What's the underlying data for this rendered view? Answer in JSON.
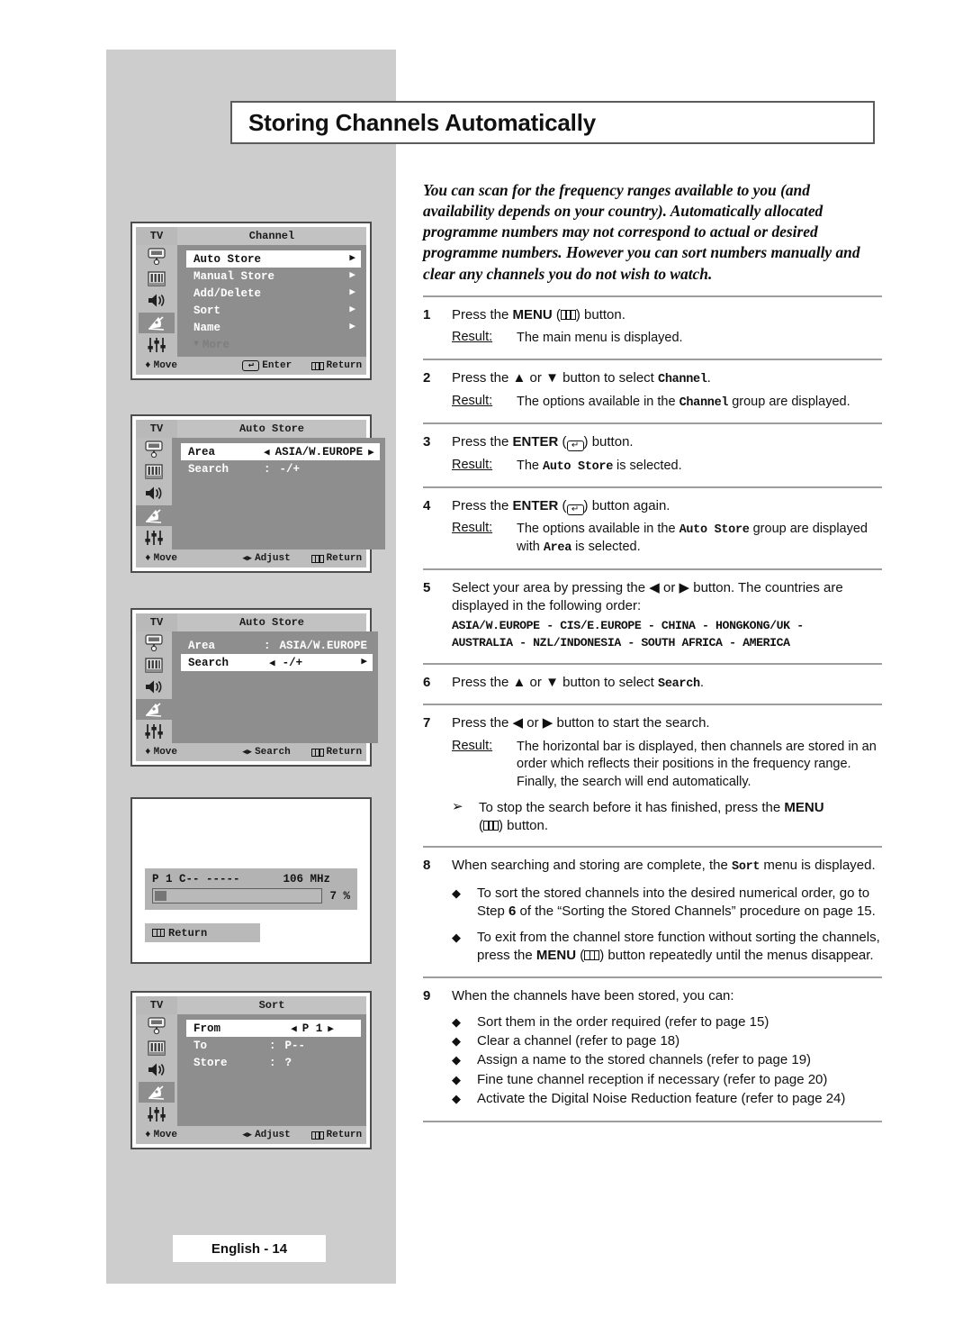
{
  "page": {
    "title": "Storing Channels Automatically",
    "footer": "English - 14"
  },
  "intro": "You can scan for the frequency ranges available to you (and availability depends on your country). Automatically allocated programme numbers may not correspond to actual or desired programme numbers. However you can sort numbers manually and clear any channels you do not wish to watch.",
  "osd": {
    "channel_menu": {
      "source_label": "TV",
      "title": "Channel",
      "items": [
        {
          "label": "Auto Store",
          "selected": true
        },
        {
          "label": "Manual Store",
          "selected": false
        },
        {
          "label": "Add/Delete",
          "selected": false
        },
        {
          "label": "Sort",
          "selected": false
        },
        {
          "label": "Name",
          "selected": false
        }
      ],
      "more_label": "More",
      "footer": {
        "move": "Move",
        "enter": "Enter",
        "return": "Return"
      }
    },
    "auto_store_area": {
      "source_label": "TV",
      "title": "Auto Store",
      "rows": [
        {
          "label": "Area",
          "value": "ASIA/W.EUROPE",
          "selected": true,
          "adjustable": true,
          "sep": ""
        },
        {
          "label": "Search",
          "value": "-/+",
          "selected": false,
          "adjustable": false,
          "sep": ":"
        }
      ],
      "footer": {
        "move": "Move",
        "adjust": "Adjust",
        "return": "Return"
      }
    },
    "auto_store_search": {
      "source_label": "TV",
      "title": "Auto Store",
      "rows": [
        {
          "label": "Area",
          "value": "ASIA/W.EUROPE",
          "selected": false,
          "adjustable": false,
          "sep": ":"
        },
        {
          "label": "Search",
          "value": "-/+",
          "selected": true,
          "adjustable": true,
          "sep": ""
        }
      ],
      "footer": {
        "move": "Move",
        "adjust": "Search",
        "return": "Return"
      }
    },
    "search_progress": {
      "channel_info": "P 1 C-- -----",
      "frequency": "106 MHz",
      "percent_label": "7 %",
      "percent_value": 7,
      "return_label": "Return"
    },
    "sort_menu": {
      "source_label": "TV",
      "title": "Sort",
      "rows": [
        {
          "label": "From",
          "value": "P 1",
          "selected": true,
          "adjustable": true,
          "sep": ""
        },
        {
          "label": "To",
          "value": "P--",
          "selected": false,
          "adjustable": false,
          "sep": ":"
        },
        {
          "label": "Store",
          "value": "?",
          "selected": false,
          "adjustable": false,
          "sep": ":"
        }
      ],
      "footer": {
        "move": "Move",
        "adjust": "Adjust",
        "return": "Return"
      }
    },
    "icons": [
      "picture-icon",
      "sound-bars-icon",
      "speaker-icon",
      "satellite-dish-icon",
      "setup-sliders-icon"
    ]
  },
  "steps": {
    "s1": {
      "num": "1",
      "pre": "Press the ",
      "kbd": "MENU",
      "post": ") button.",
      "result_label": "Result:",
      "result": "The main menu is displayed."
    },
    "s2": {
      "num": "2",
      "a": "Press the ",
      "b": " or ",
      "c": " button to select ",
      "mono": "Channel",
      "d": ".",
      "result_label": "Result:",
      "r_a": "The options available in the ",
      "r_mono": "Channel",
      "r_b": " group are displayed."
    },
    "s3": {
      "num": "3",
      "pre": "Press the ",
      "kbd": "ENTER",
      "post": ") button.",
      "result_label": "Result:",
      "r_a": "The ",
      "r_mono": "Auto Store",
      "r_b": " is selected."
    },
    "s4": {
      "num": "4",
      "pre": "Press the ",
      "kbd": "ENTER",
      "post": ") button again.",
      "result_label": "Result:",
      "r_a": "The options available in the ",
      "r_mono": "Auto Store",
      "r_b": " group are displayed with ",
      "r_mono2": "Area",
      "r_c": " is selected."
    },
    "s5": {
      "num": "5",
      "a": "Select your area by pressing the ",
      "b": " or ",
      "c": " button. The countries are displayed in the following order:",
      "countries_line1": "ASIA/W.EUROPE - CIS/E.EUROPE - CHINA - HONGKONG/UK -",
      "countries_line2": "AUSTRALIA - NZL/INDONESIA - SOUTH AFRICA - AMERICA"
    },
    "s6": {
      "num": "6",
      "a": "Press the ",
      "b": " or ",
      "c": " button to select ",
      "mono": "Search",
      "d": "."
    },
    "s7": {
      "num": "7",
      "a": "Press the ",
      "b": " or ",
      "c": " button to start the search.",
      "result_label": "Result:",
      "result": "The horizontal bar is displayed, then channels are stored in an order which reflects their positions in the frequency range. Finally, the search will end automatically.",
      "note_a": "To stop the search before it has finished, press the ",
      "note_kbd": "MENU",
      "note_b": ") button."
    },
    "s8": {
      "num": "8",
      "a": "When searching and storing are complete, the ",
      "mono": "Sort",
      "b": " menu is displayed.",
      "b1_a": "To sort the stored channels into the desired numerical order, go to Step ",
      "b1_num": "6",
      "b1_b": " of the “Sorting the Stored Channels” procedure on page 15.",
      "b2_a": "To exit from the channel store function without sorting the channels, press the ",
      "b2_kbd": "MENU",
      "b2_b": ") button repeatedly until the menus disappear."
    },
    "s9": {
      "num": "9",
      "a": "When the channels have been stored, you can:",
      "items": [
        "Sort them in the order required (refer to page 15)",
        "Clear a channel (refer to page 18)",
        "Assign a name to the stored channels (refer to page 19)",
        "Fine tune channel reception if necessary (refer to page 20)",
        "Activate the Digital Noise Reduction feature (refer to page 24)"
      ]
    }
  },
  "glyphs": {
    "up": "▲",
    "down": "▼",
    "left": "◀",
    "right": "▶",
    "diamond": "◆",
    "arrowhead": "➢",
    "updown": "♦",
    "enter_arrow": "↵"
  }
}
